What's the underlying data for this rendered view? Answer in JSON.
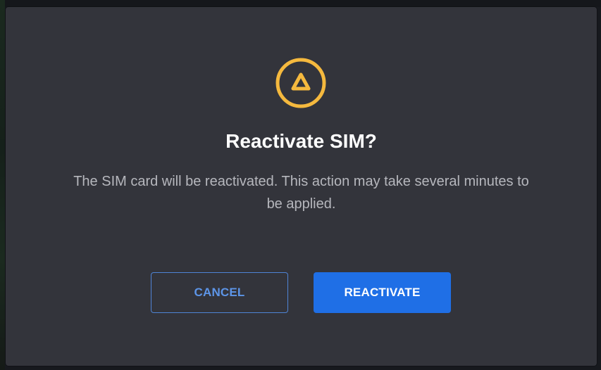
{
  "dialog": {
    "icon": "warning-triangle-icon",
    "accent_color": "#f5b93e",
    "title": "Reactivate SIM?",
    "message": "The SIM card will be reactivated. This action may take several minutes to be applied.",
    "cancel_label": "CANCEL",
    "confirm_label": "REACTIVATE",
    "primary_color": "#1f6fe6"
  }
}
